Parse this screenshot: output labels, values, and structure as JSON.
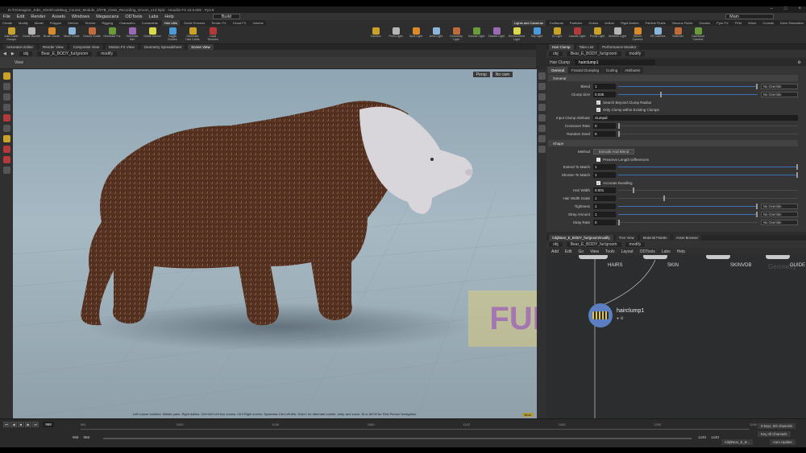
{
  "window": {
    "title": "D:/CGImagine_Jobs_2023/CodeBug_Course_Module_2/07B_Class_Recording_Groom_v13.hiplc - Houdini FX 19.5.605 - Py3.9"
  },
  "menu": [
    "File",
    "Edit",
    "Render",
    "Assets",
    "Windows",
    "Megascans",
    "ODTools",
    "Labs",
    "Help"
  ],
  "menu_desktop": "Build",
  "menu_workspace": "Main",
  "shelf": {
    "tabs_left": [
      "Create",
      "Modify",
      "Model",
      "Polygon",
      "Deform",
      "Texture",
      "Rigging",
      "Characters",
      "Constraints",
      "Hair Utils",
      "Guide Process",
      "Terrain FX",
      "Cloud FX",
      "Volume"
    ],
    "tabs_right": [
      "Lights and Cameras",
      "Collisions",
      "Particles",
      "Grains",
      "Vellum",
      "Rigid Bodies",
      "Particle Fluids",
      "Viscous Fluids",
      "Oceans",
      "Pyro FX",
      "FEM",
      "Wires",
      "Crowds",
      "Drive Simulation"
    ],
    "tools_left": [
      "Add Guide Groups",
      "Guide Bundle",
      "Brush Guide",
      "Move Guide",
      "Groom Guide",
      "Generate Fur",
      "Generate Hair",
      "Guide Advect",
      "Toggle Guides",
      "Generate Hair Cards",
      "Load Textures"
    ],
    "tools_right": [
      "Camera",
      "Point Light",
      "Spot Light",
      "Area Light",
      "Geometry Light",
      "Volume Light",
      "Distant Light",
      "Environment Light",
      "Sky Light",
      "GI Light",
      "Caustic Light",
      "Portal Light",
      "Ambient Light",
      "Stereo Camera",
      "VR Camera",
      "Switcher",
      "Gamepad Camera"
    ]
  },
  "viewer": {
    "tabs": [
      "Animation Editor",
      "Render View",
      "Composite View",
      "Motion FX View",
      "Geometry Spreadsheet",
      "Scene View"
    ],
    "path": [
      "obj",
      "Bear_E_BODY_fur/groom",
      "modify"
    ],
    "label": "View",
    "persp": "Persp",
    "cam": "No cam",
    "status": "Left mouse tumbles. Middle pans. Right dollies. Ctrl+Alt+Left box zooms. Ctrl+Right zooms. Spacebar-Ctrl-Left tilts. Hold L for alternate tumble, dolly, and zoom.    M or Alt+M for First Person Navigation.",
    "badge": "FUR",
    "corner": "Bear"
  },
  "right": {
    "tabs": [
      "Hair Clump",
      "Take List",
      "Performance Monitor"
    ],
    "path": [
      "obj",
      "Bear_E_BODY_fur/groom",
      "modify"
    ],
    "node_type": "Hair Clump",
    "node_name": "hairclump1",
    "param_tabs": [
      "General",
      "Fractal Clumping",
      "Curling",
      "Attributes"
    ],
    "section_general": "General",
    "section_shape": "Shape",
    "params": {
      "blend_label": "Blend",
      "blend_val": "1",
      "blend_dd": "No Override",
      "clump_size_label": "Clump Size",
      "clump_size_val": "0.035",
      "clump_size_dd": "No Override",
      "search_beyond": "Search Beyond Clump Radius",
      "only_clump": "Only Clump within Existing Clumps",
      "input_attr_label": "Input Clump Attribute",
      "input_attr_val": "clumpid",
      "crossover_label": "Crossover Rate",
      "crossover_val": "0",
      "random_seed_label": "Random Seed",
      "random_seed_val": "0",
      "method_label": "Method",
      "method_val": "Extrude And Blend",
      "preserve": "Preserve Length Differences",
      "extend_label": "Extend To Match",
      "extend_val": "1",
      "shorten_label": "Shorten To Match",
      "shorten_val": "1",
      "accurate": "Accurate Bundling",
      "hair_width_label": "Hair Width",
      "hair_width_val": "0.001",
      "hair_width_scale_label": "Hair Width Scale",
      "hair_width_scale_val": "1",
      "tightness_label": "Tightness",
      "tightness_val": "1",
      "tightness_dd": "No Override",
      "stray_amount_label": "Stray Amount",
      "stray_amount_val": "1",
      "stray_amount_dd": "No Override",
      "stray_rate_label": "Stray Rate",
      "stray_rate_val": "0",
      "stray_rate_dd": "No Override"
    },
    "net_tabs": [
      "/obj/Bear_E_BODY_fur/groom/modify",
      "Tree View",
      "Material Palette",
      "Asset Browser"
    ],
    "net_path": [
      "obj",
      "Bear_E_BODY_fur/groom",
      "modify"
    ],
    "net_menu": [
      "Add",
      "Edit",
      "Go",
      "View",
      "Tools",
      "Layout",
      "ODTools",
      "Labs",
      "Help"
    ],
    "nodes": {
      "hairs": "HAIRS",
      "skin": "SKIN",
      "skinvdb": "SKINVDB",
      "guide": "GUIDE",
      "hairclump": "hairclump1",
      "geometry": "Geometry"
    }
  },
  "timeline": {
    "frame": "961",
    "start": "968",
    "start2": "968",
    "ticks": [
      "961",
      "1000",
      "1040",
      "1080",
      "1120",
      "1160",
      "1200",
      "1240"
    ],
    "end": "1240",
    "end2": "1240",
    "keys": "0 keys, 0/0 channels",
    "key_all": "Key All Channels",
    "auto_update": "Auto Update",
    "path": "/obj/Bear_E_B..."
  }
}
